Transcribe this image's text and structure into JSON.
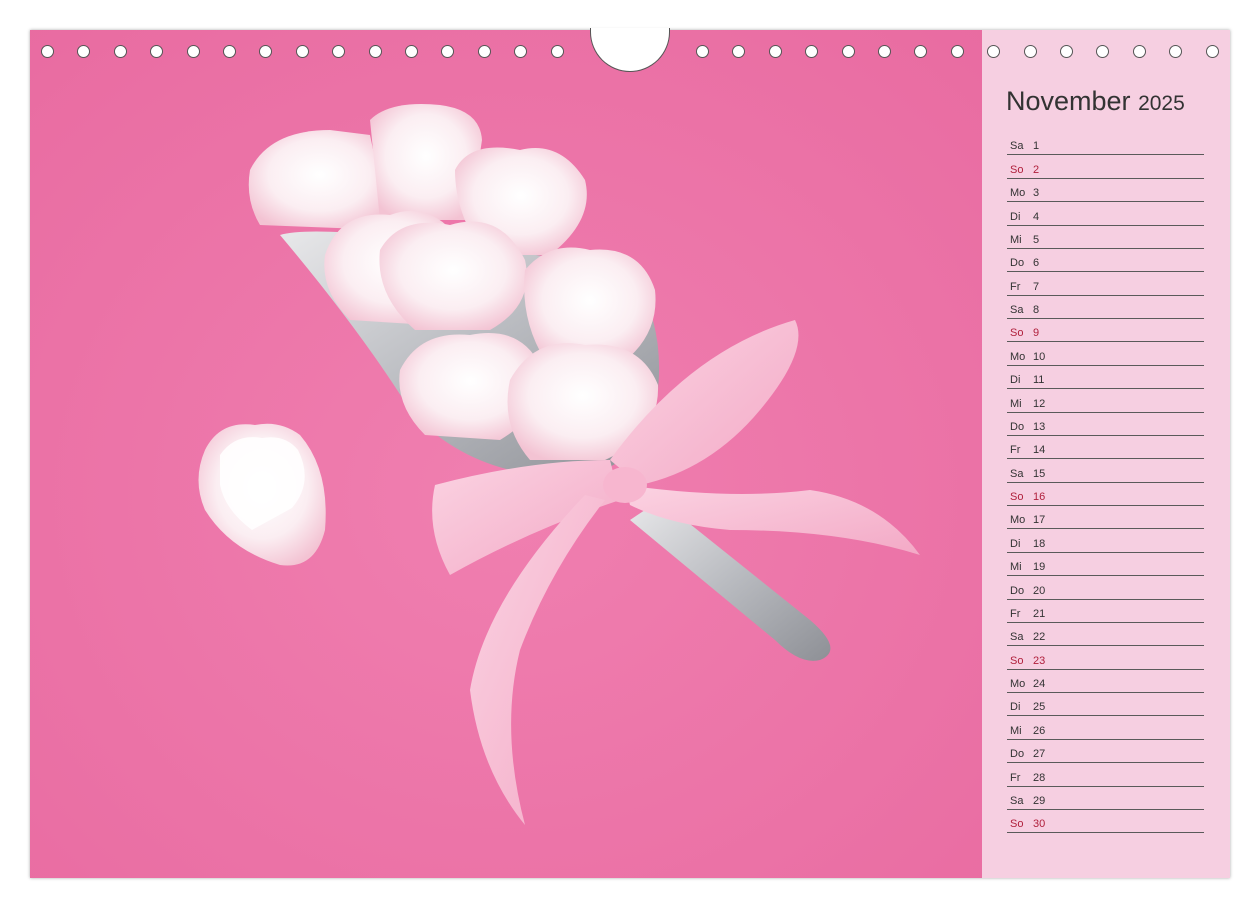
{
  "calendar": {
    "month": "November",
    "year": "2025",
    "days": [
      {
        "weekday": "Sa",
        "day": "1"
      },
      {
        "weekday": "So",
        "day": "2",
        "sunday": true
      },
      {
        "weekday": "Mo",
        "day": "3"
      },
      {
        "weekday": "Di",
        "day": "4"
      },
      {
        "weekday": "Mi",
        "day": "5"
      },
      {
        "weekday": "Do",
        "day": "6"
      },
      {
        "weekday": "Fr",
        "day": "7"
      },
      {
        "weekday": "Sa",
        "day": "8"
      },
      {
        "weekday": "So",
        "day": "9",
        "sunday": true
      },
      {
        "weekday": "Mo",
        "day": "10"
      },
      {
        "weekday": "Di",
        "day": "11"
      },
      {
        "weekday": "Mi",
        "day": "12"
      },
      {
        "weekday": "Do",
        "day": "13"
      },
      {
        "weekday": "Fr",
        "day": "14"
      },
      {
        "weekday": "Sa",
        "day": "15"
      },
      {
        "weekday": "So",
        "day": "16",
        "sunday": true
      },
      {
        "weekday": "Mo",
        "day": "17"
      },
      {
        "weekday": "Di",
        "day": "18"
      },
      {
        "weekday": "Mi",
        "day": "19"
      },
      {
        "weekday": "Do",
        "day": "20"
      },
      {
        "weekday": "Fr",
        "day": "21"
      },
      {
        "weekday": "Sa",
        "day": "22"
      },
      {
        "weekday": "So",
        "day": "23",
        "sunday": true
      },
      {
        "weekday": "Mo",
        "day": "24"
      },
      {
        "weekday": "Di",
        "day": "25"
      },
      {
        "weekday": "Mi",
        "day": "26"
      },
      {
        "weekday": "Do",
        "day": "27"
      },
      {
        "weekday": "Fr",
        "day": "28"
      },
      {
        "weekday": "Sa",
        "day": "29"
      },
      {
        "weekday": "So",
        "day": "30",
        "sunday": true
      }
    ]
  },
  "photo": {
    "subject": "heart-marshmallows-on-scoop-with-pink-ribbon"
  },
  "colors": {
    "photo_background": "#ea74a7",
    "sidebar_background": "#f6cfe1",
    "sunday_text": "#b0203c",
    "weekday_text": "#333333"
  },
  "binding": {
    "hole_count": 32
  }
}
